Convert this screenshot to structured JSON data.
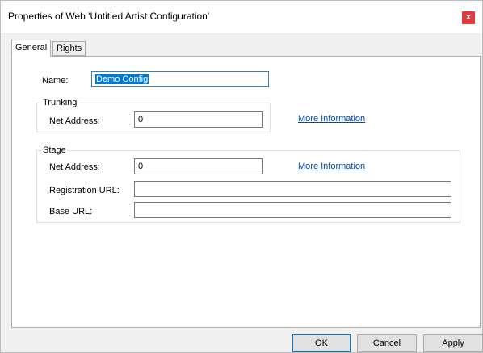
{
  "window": {
    "title": "Properties of Web 'Untitled Artist Configuration'",
    "close_glyph": "x"
  },
  "tabs": [
    {
      "label": "General",
      "active": true
    },
    {
      "label": "Rights",
      "active": false
    }
  ],
  "general": {
    "name_label": "Name:",
    "name_value": "Demo Config",
    "trunking": {
      "legend": "Trunking",
      "net_address_label": "Net Address:",
      "net_address_value": "0",
      "more_info_link": "More Information"
    },
    "stage": {
      "legend": "Stage",
      "net_address_label": "Net Address:",
      "net_address_value": "0",
      "more_info_link": "More Information",
      "registration_url_label": "Registration URL:",
      "registration_url_value": "",
      "base_url_label": "Base URL:",
      "base_url_value": ""
    }
  },
  "buttons": {
    "ok": "OK",
    "cancel": "Cancel",
    "apply": "Apply"
  },
  "colors": {
    "close_button": "#e0393e",
    "selection": "#0078d7",
    "link": "#0645ad"
  }
}
